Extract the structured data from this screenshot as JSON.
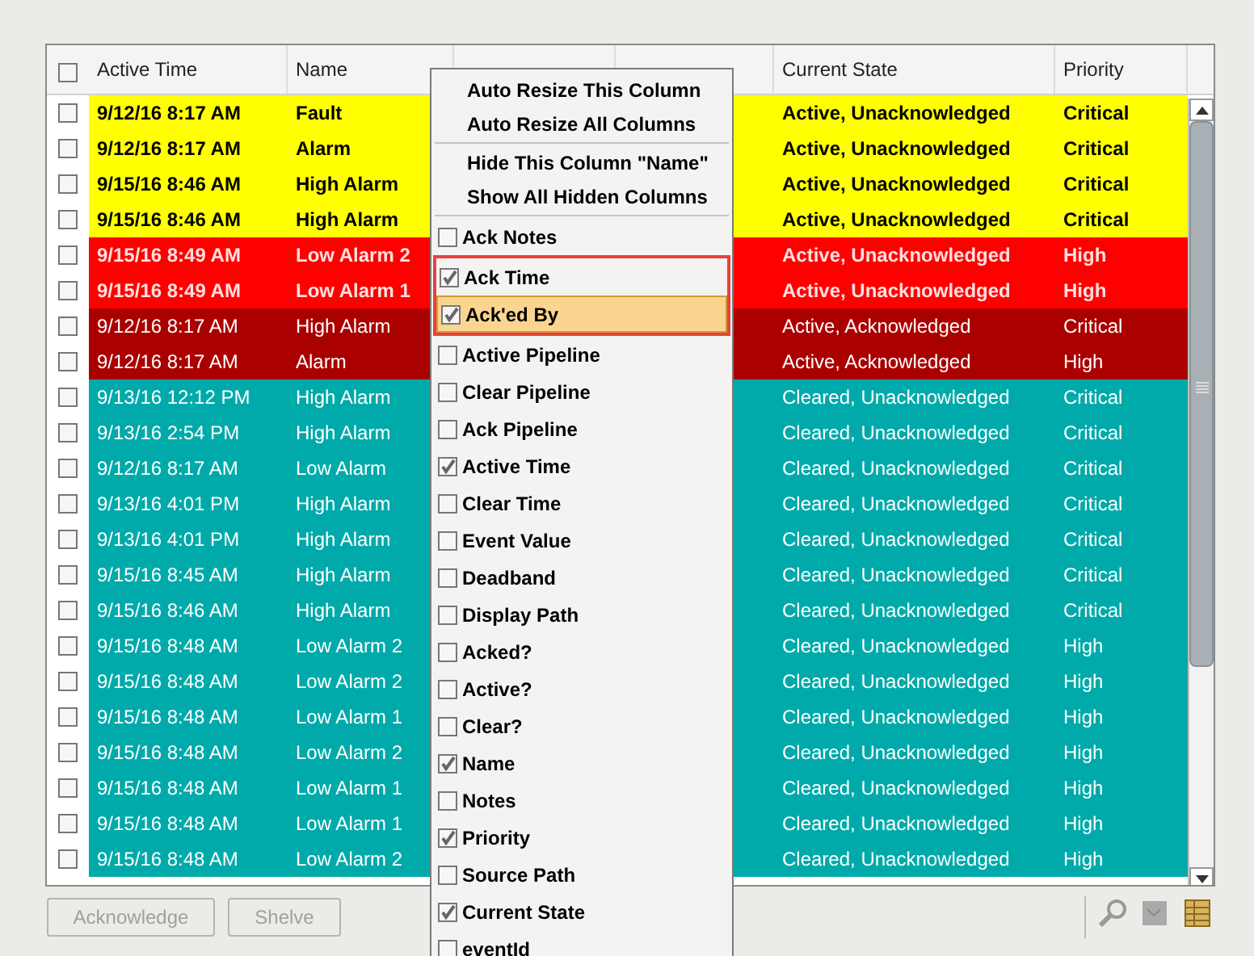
{
  "table": {
    "select_all": {
      "checked": false
    },
    "columns": [
      "Active Time",
      "Name",
      "",
      "",
      "Current State",
      "Priority"
    ],
    "rows": [
      {
        "kind": "unacked_critical",
        "checked": false,
        "active_time": "9/12/16 8:17 AM",
        "name": "Fault",
        "state": "Active, Unacknowledged",
        "priority": "Critical"
      },
      {
        "kind": "unacked_critical",
        "checked": false,
        "active_time": "9/12/16 8:17 AM",
        "name": "Alarm",
        "state": "Active, Unacknowledged",
        "priority": "Critical"
      },
      {
        "kind": "unacked_critical",
        "checked": false,
        "active_time": "9/15/16 8:46 AM",
        "name": "High Alarm",
        "state": "Active, Unacknowledged",
        "priority": "Critical"
      },
      {
        "kind": "unacked_critical",
        "checked": false,
        "active_time": "9/15/16 8:46 AM",
        "name": "High Alarm",
        "state": "Active, Unacknowledged",
        "priority": "Critical"
      },
      {
        "kind": "unacked_high",
        "checked": false,
        "active_time": "9/15/16 8:49 AM",
        "name": "Low Alarm 2",
        "state": "Active, Unacknowledged",
        "priority": "High"
      },
      {
        "kind": "unacked_high",
        "checked": false,
        "active_time": "9/15/16 8:49 AM",
        "name": "Low Alarm 1",
        "state": "Active, Unacknowledged",
        "priority": "High"
      },
      {
        "kind": "acked",
        "checked": false,
        "active_time": "9/12/16 8:17 AM",
        "name": "High Alarm",
        "state": "Active, Acknowledged",
        "priority": "Critical"
      },
      {
        "kind": "acked",
        "checked": false,
        "active_time": "9/12/16 8:17 AM",
        "name": "Alarm",
        "state": "Active, Acknowledged",
        "priority": "High"
      },
      {
        "kind": "cleared",
        "checked": false,
        "active_time": "9/13/16 12:12 PM",
        "name": "High Alarm",
        "state": "Cleared, Unacknowledged",
        "priority": "Critical"
      },
      {
        "kind": "cleared",
        "checked": false,
        "active_time": "9/13/16 2:54 PM",
        "name": "High Alarm",
        "state": "Cleared, Unacknowledged",
        "priority": "Critical"
      },
      {
        "kind": "cleared",
        "checked": false,
        "active_time": "9/12/16 8:17 AM",
        "name": "Low Alarm",
        "state": "Cleared, Unacknowledged",
        "priority": "Critical"
      },
      {
        "kind": "cleared",
        "checked": false,
        "active_time": "9/13/16 4:01 PM",
        "name": "High Alarm",
        "state": "Cleared, Unacknowledged",
        "priority": "Critical"
      },
      {
        "kind": "cleared",
        "checked": false,
        "active_time": "9/13/16 4:01 PM",
        "name": "High Alarm",
        "state": "Cleared, Unacknowledged",
        "priority": "Critical"
      },
      {
        "kind": "cleared",
        "checked": false,
        "active_time": "9/15/16 8:45 AM",
        "name": "High Alarm",
        "state": "Cleared, Unacknowledged",
        "priority": "Critical"
      },
      {
        "kind": "cleared",
        "checked": false,
        "active_time": "9/15/16 8:46 AM",
        "name": "High Alarm",
        "state": "Cleared, Unacknowledged",
        "priority": "Critical"
      },
      {
        "kind": "cleared",
        "checked": false,
        "active_time": "9/15/16 8:48 AM",
        "name": "Low Alarm 2",
        "state": "Cleared, Unacknowledged",
        "priority": "High"
      },
      {
        "kind": "cleared",
        "checked": false,
        "active_time": "9/15/16 8:48 AM",
        "name": "Low Alarm 2",
        "state": "Cleared, Unacknowledged",
        "priority": "High"
      },
      {
        "kind": "cleared",
        "checked": false,
        "active_time": "9/15/16 8:48 AM",
        "name": "Low Alarm 1",
        "state": "Cleared, Unacknowledged",
        "priority": "High"
      },
      {
        "kind": "cleared",
        "checked": false,
        "active_time": "9/15/16 8:48 AM",
        "name": "Low Alarm 2",
        "state": "Cleared, Unacknowledged",
        "priority": "High"
      },
      {
        "kind": "cleared",
        "checked": false,
        "active_time": "9/15/16 8:48 AM",
        "name": "Low Alarm 1",
        "state": "Cleared, Unacknowledged",
        "priority": "High"
      },
      {
        "kind": "cleared",
        "checked": false,
        "active_time": "9/15/16 8:48 AM",
        "name": "Low Alarm 1",
        "state": "Cleared, Unacknowledged",
        "priority": "High"
      },
      {
        "kind": "cleared",
        "checked": false,
        "active_time": "9/15/16 8:48 AM",
        "name": "Low Alarm 2",
        "state": "Cleared, Unacknowledged",
        "priority": "High"
      }
    ]
  },
  "buttons": [
    {
      "label": "Acknowledge",
      "disabled": true
    },
    {
      "label": "Shelve",
      "disabled": true
    }
  ],
  "context_menu": {
    "actions": [
      [
        "Auto Resize This Column",
        "Auto Resize All Columns"
      ],
      [
        "Hide This Column \"Name\"",
        "Show All Hidden Columns"
      ]
    ],
    "items": [
      {
        "label": "Ack Notes",
        "checked": false,
        "selected": false,
        "framed": false
      },
      {
        "label": "Ack Time",
        "checked": true,
        "selected": false,
        "framed": true
      },
      {
        "label": "Ack'ed By",
        "checked": true,
        "selected": true,
        "framed": true
      },
      {
        "label": "Active Pipeline",
        "checked": false,
        "selected": false,
        "framed": false
      },
      {
        "label": "Clear Pipeline",
        "checked": false,
        "selected": false,
        "framed": false
      },
      {
        "label": "Ack Pipeline",
        "checked": false,
        "selected": false,
        "framed": false
      },
      {
        "label": "Active Time",
        "checked": true,
        "selected": false,
        "framed": false
      },
      {
        "label": "Clear Time",
        "checked": false,
        "selected": false,
        "framed": false
      },
      {
        "label": "Event Value",
        "checked": false,
        "selected": false,
        "framed": false
      },
      {
        "label": "Deadband",
        "checked": false,
        "selected": false,
        "framed": false
      },
      {
        "label": "Display Path",
        "checked": false,
        "selected": false,
        "framed": false
      },
      {
        "label": "Acked?",
        "checked": false,
        "selected": false,
        "framed": false
      },
      {
        "label": "Active?",
        "checked": false,
        "selected": false,
        "framed": false
      },
      {
        "label": "Clear?",
        "checked": false,
        "selected": false,
        "framed": false
      },
      {
        "label": "Name",
        "checked": true,
        "selected": false,
        "framed": false
      },
      {
        "label": "Notes",
        "checked": false,
        "selected": false,
        "framed": false
      },
      {
        "label": "Priority",
        "checked": true,
        "selected": false,
        "framed": false
      },
      {
        "label": "Source Path",
        "checked": false,
        "selected": false,
        "framed": false
      },
      {
        "label": "Current State",
        "checked": true,
        "selected": false,
        "framed": false
      },
      {
        "label": "eventId",
        "checked": false,
        "selected": false,
        "framed": false
      }
    ]
  }
}
